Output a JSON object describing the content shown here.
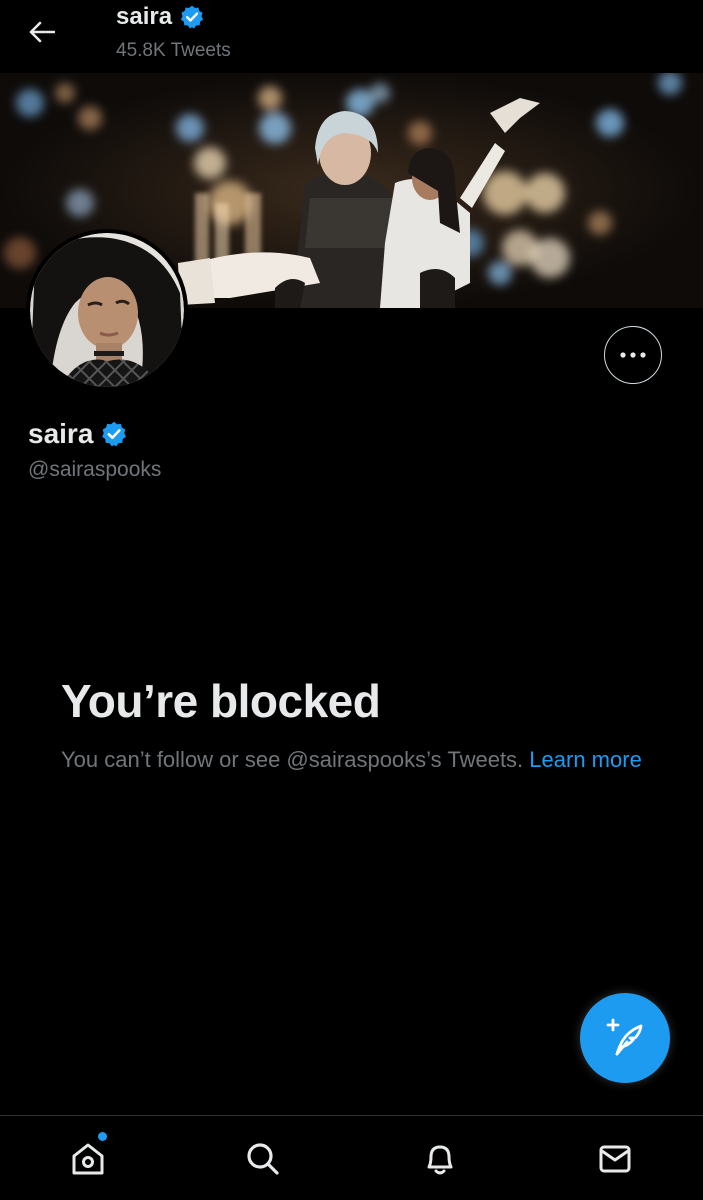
{
  "header": {
    "name": "saira",
    "tweet_count": "45.8K Tweets",
    "back_icon": "arrow-left-icon",
    "verified_icon": "verified-badge-icon"
  },
  "profile": {
    "display_name": "saira",
    "handle": "@sairaspooks",
    "more_icon": "more-horizontal-icon"
  },
  "blocked": {
    "title": "You’re blocked",
    "description": "You can’t follow or see @sairaspooks’s Tweets.",
    "learn_more": "Learn more"
  },
  "fab": {
    "icon": "compose-tweet-icon"
  },
  "bottom_nav": {
    "items": [
      {
        "icon": "home-icon"
      },
      {
        "icon": "search-icon"
      },
      {
        "icon": "bell-icon"
      },
      {
        "icon": "mail-icon"
      }
    ]
  },
  "colors": {
    "background": "#000000",
    "primary_text": "#e7e9ea",
    "secondary_text": "#71767b",
    "accent": "#1d9bf0",
    "border": "#2f3336"
  }
}
